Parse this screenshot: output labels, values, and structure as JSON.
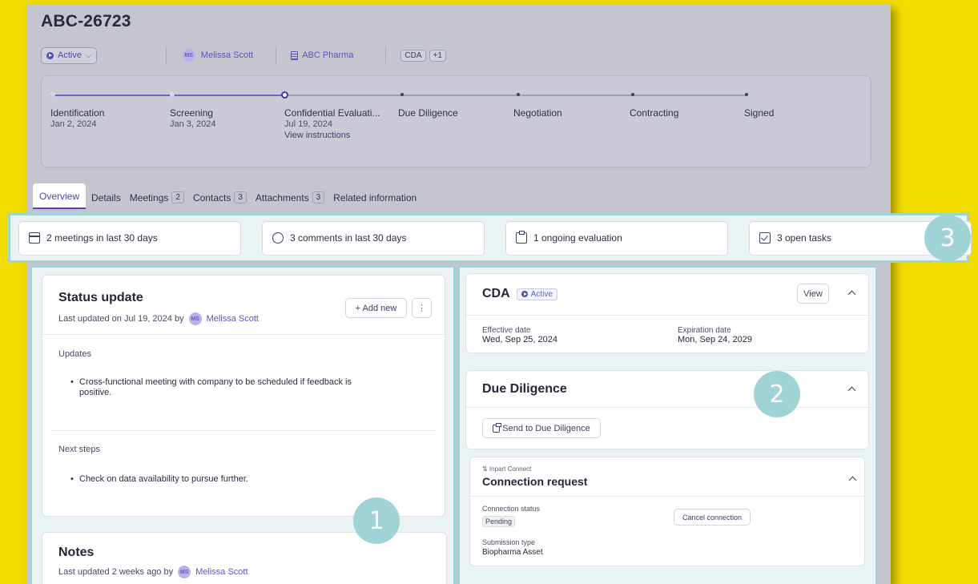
{
  "header": {
    "case_id": "ABC-26723",
    "status": "Active",
    "owner_initials": "MS",
    "owner_name": "Melissa Scott",
    "company": "ABC Pharma",
    "tag": "CDA",
    "tag_more": "+1"
  },
  "pipeline": {
    "stages": [
      {
        "name": "Identification",
        "date": "Jan 2, 2024",
        "link": ""
      },
      {
        "name": "Screening",
        "date": "Jan 3, 2024",
        "link": ""
      },
      {
        "name": "Confidential Evaluati...",
        "date": "Jul 19, 2024",
        "link": "View instructions"
      },
      {
        "name": "Due Diligence",
        "date": "",
        "link": ""
      },
      {
        "name": "Negotiation",
        "date": "",
        "link": ""
      },
      {
        "name": "Contracting",
        "date": "",
        "link": ""
      },
      {
        "name": "Signed",
        "date": "",
        "link": ""
      }
    ]
  },
  "tabs": [
    {
      "label": "Overview",
      "count": ""
    },
    {
      "label": "Details",
      "count": ""
    },
    {
      "label": "Meetings",
      "count": "2"
    },
    {
      "label": "Contacts",
      "count": "3"
    },
    {
      "label": "Attachments",
      "count": "3"
    },
    {
      "label": "Related information",
      "count": ""
    }
  ],
  "summary": {
    "meetings": "2 meetings in last 30 days",
    "comments": "3 comments in last 30 days",
    "evaluation": "1 ongoing evaluation",
    "tasks": "3 open tasks"
  },
  "status_update": {
    "title": "Status update",
    "updated_prefix": "Last updated on Jul 19, 2024  by",
    "author_initials": "MS",
    "author": "Melissa Scott",
    "add_new": "+ Add new",
    "more": "⋮",
    "updates_label": "Updates",
    "update_item_line1": "Cross-functional meeting with company to be scheduled if feedback is",
    "update_item_line2": "positive.",
    "next_steps_label": "Next steps",
    "next_step_item": "Check on data availability to pursue further."
  },
  "notes": {
    "title": "Notes",
    "updated_prefix": "Last updated 2 weeks ago by",
    "author_initials": "MS",
    "author": "Melissa Scott"
  },
  "cda": {
    "title": "CDA",
    "status": "Active",
    "view": "View",
    "effective_label": "Effective date",
    "effective_value": "Wed, Sep 25, 2024",
    "expiration_label": "Expiration date",
    "expiration_value": "Mon, Sep 24, 2029"
  },
  "due_diligence": {
    "title": "Due Diligence",
    "send_button": "Send to Due Diligence"
  },
  "connection": {
    "source": "⇅ Inpart Connect",
    "title": "Connection request",
    "status_label": "Connection status",
    "status_value": "Pending",
    "cancel": "Cancel connection",
    "type_label": "Submission type",
    "type_value": "Biopharma Asset"
  },
  "callouts": [
    "1",
    "2",
    "3"
  ],
  "colors": {
    "background": "#f1dc00",
    "highlight": "#9fd3d6",
    "accent": "#4a46b8"
  }
}
